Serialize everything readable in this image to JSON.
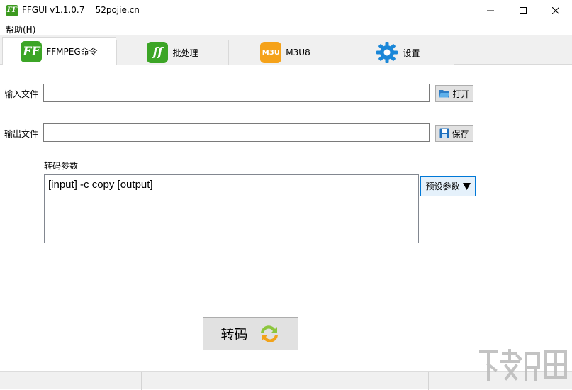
{
  "window": {
    "title": "FFGUI v1.1.0.7    52pojie.cn",
    "app_icon_text": "FF"
  },
  "menu": {
    "help_label": "帮助(H)"
  },
  "tabs": [
    {
      "label": "FFMPEG命令",
      "icon": "ff-logo-icon",
      "icon_text": "FF",
      "active": true
    },
    {
      "label": "批处理",
      "icon": "ff-batch-icon",
      "icon_text": "ff",
      "active": false
    },
    {
      "label": "M3U8",
      "icon": "m3u-icon",
      "icon_text": "M3U",
      "active": false
    },
    {
      "label": "设置",
      "icon": "gear-icon",
      "active": false
    }
  ],
  "form": {
    "input_label": "输入文件",
    "input_value": "",
    "open_button": "打开",
    "output_label": "输出文件",
    "output_value": "",
    "save_button": "保存",
    "params_label": "转码参数",
    "params_value": "[input] -c copy [output]",
    "preset_button": "预设参数"
  },
  "actions": {
    "convert_button": "转码"
  },
  "colors": {
    "accent_blue": "#0078d7",
    "tab_icon_green": "#3ca526",
    "tab_icon_orange": "#f5a21a",
    "gear_blue": "#1a87d8"
  }
}
